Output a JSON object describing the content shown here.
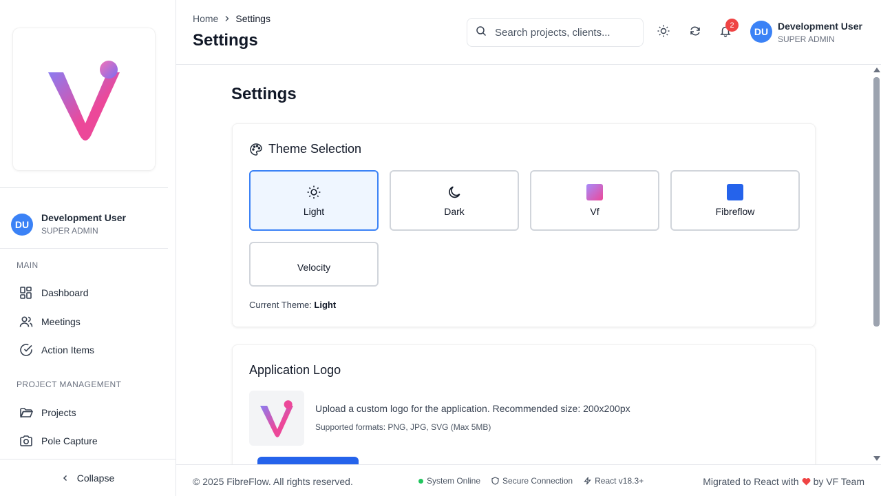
{
  "sidebar": {
    "user": {
      "initials": "DU",
      "name": "Development User",
      "role": "SUPER ADMIN"
    },
    "sections": [
      {
        "title": "MAIN",
        "items": [
          {
            "label": "Dashboard",
            "icon": "dashboard-icon"
          },
          {
            "label": "Meetings",
            "icon": "users-icon"
          },
          {
            "label": "Action Items",
            "icon": "check-circle-icon"
          }
        ]
      },
      {
        "title": "PROJECT MANAGEMENT",
        "items": [
          {
            "label": "Projects",
            "icon": "folder-icon"
          },
          {
            "label": "Pole Capture",
            "icon": "camera-icon"
          }
        ]
      }
    ],
    "collapse_label": "Collapse"
  },
  "header": {
    "breadcrumb": {
      "home": "Home",
      "current": "Settings"
    },
    "title": "Settings",
    "search_placeholder": "Search projects, clients...",
    "notification_count": "2",
    "user": {
      "initials": "DU",
      "name": "Development User",
      "role": "SUPER ADMIN"
    }
  },
  "main": {
    "title": "Settings",
    "theme_card": {
      "title": "Theme Selection",
      "options": [
        {
          "label": "Light",
          "icon": "sun-icon",
          "active": true
        },
        {
          "label": "Dark",
          "icon": "moon-icon"
        },
        {
          "label": "Vf",
          "icon": "gradient-swatch"
        },
        {
          "label": "Fibreflow",
          "icon": "blue-swatch"
        },
        {
          "label": "Velocity",
          "icon": ""
        }
      ],
      "current_label": "Current Theme:",
      "current_value": "Light"
    },
    "logo_card": {
      "title": "Application Logo",
      "description": "Upload a custom logo for the application. Recommended size: 200x200px",
      "formats": "Supported formats: PNG, JPG, SVG (Max 5MB)"
    }
  },
  "footer": {
    "copyright": "© 2025 FibreFlow. All rights reserved.",
    "status_online": "System Online",
    "status_secure": "Secure Connection",
    "status_react": "React v18.3+",
    "credit_prefix": "Migrated to React with",
    "credit_suffix": "by VF Team"
  },
  "colors": {
    "accent": "#3b82f6",
    "primary_button": "#2563eb",
    "online": "#22c55e",
    "badge": "#ef4444",
    "logo_gradient_start": "#8b7cf0",
    "logo_gradient_end": "#ec4899"
  }
}
